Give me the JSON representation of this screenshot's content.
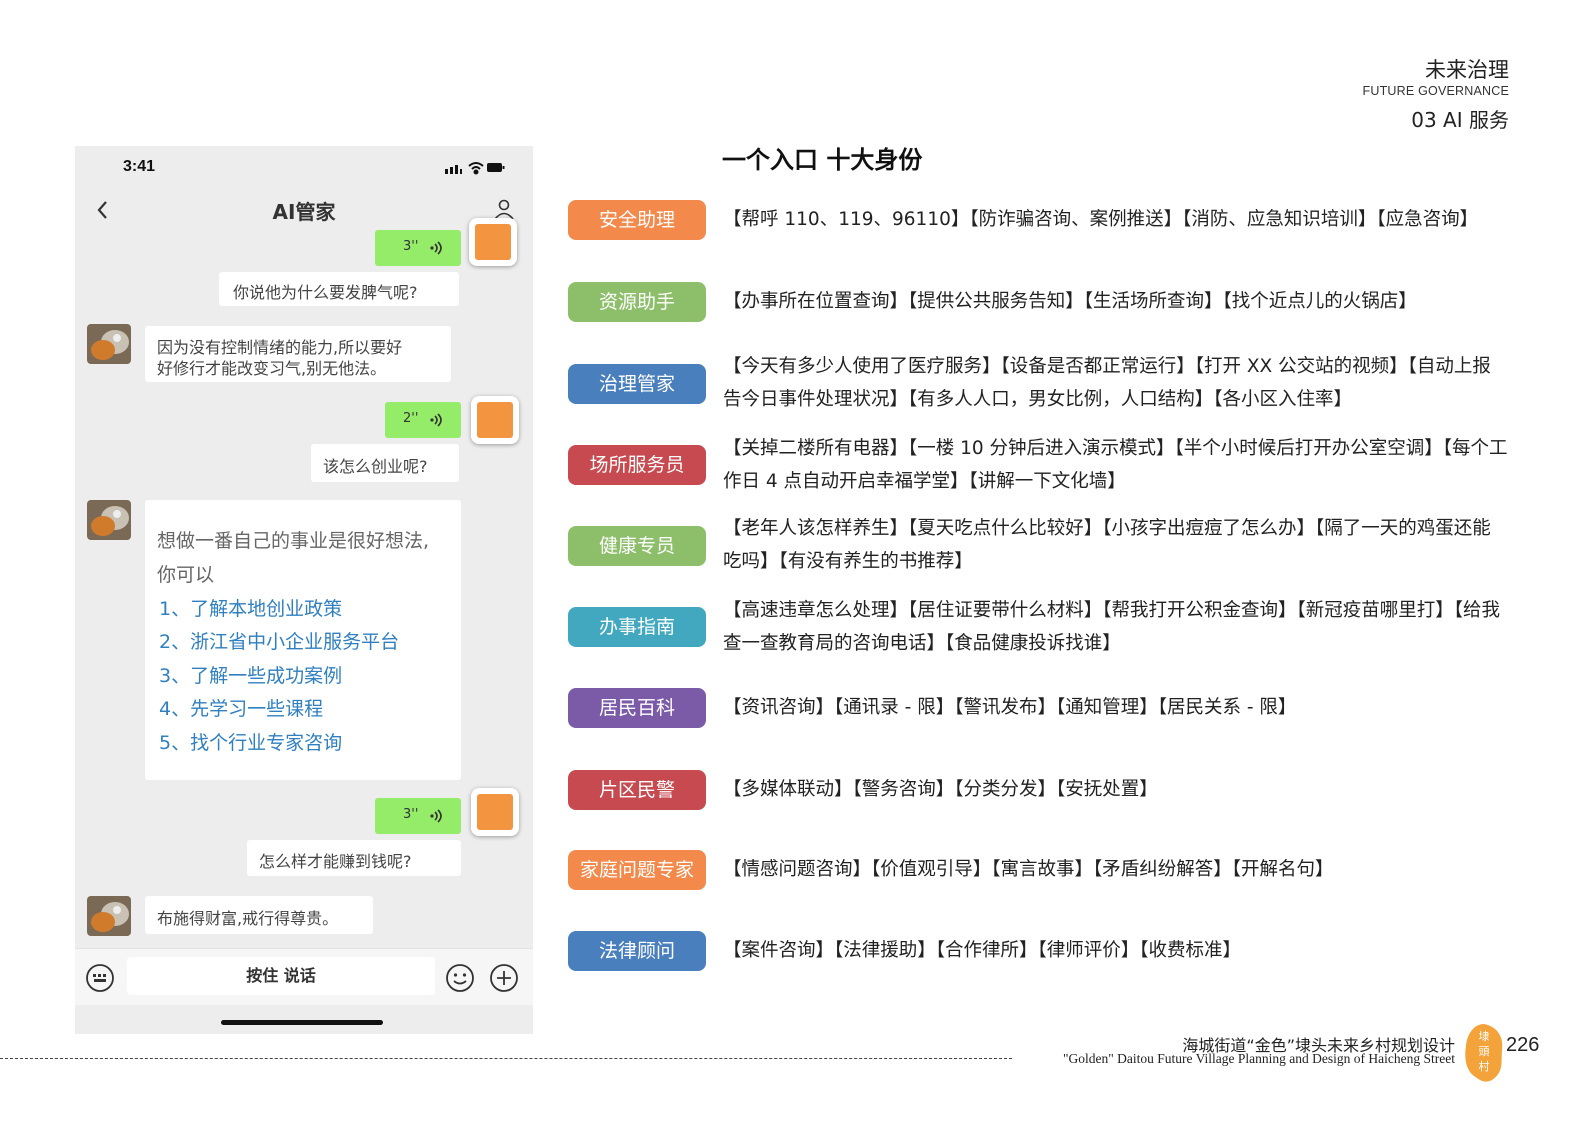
{
  "header": {
    "title_cn": "未来治理",
    "title_en": "FUTURE GOVERNANCE",
    "section": "03 AI 服务"
  },
  "phone": {
    "status_time": "3:41",
    "nav_title": "AI管家",
    "messages": {
      "voice1_duration": "3''",
      "user_text1": "你说他为什么要发脾气呢?",
      "bot_text1_line1": "因为没有控制情绪的能力,所以要好",
      "bot_text1_line2": "好修行才能改变习气,别无他法。",
      "voice2_duration": "2''",
      "user_text2": "该怎么创业呢?",
      "bot_text2_line1": "想做一番自己的事业是很好想法,",
      "bot_text2_line2": "你可以",
      "bot_list": [
        "1、了解本地创业政策",
        "2、浙江省中小企业服务平台",
        "3、了解一些成功案例",
        "4、先学习一些课程",
        "5、找个行业专家咨询"
      ],
      "voice3_duration": "3''",
      "user_text3": "怎么样才能赚到钱呢?",
      "bot_text3": "布施得财富,戒行得尊贵。"
    },
    "input_label": "按住 说话"
  },
  "main": {
    "title": "一个入口   十大身份",
    "roles": [
      {
        "name": "安全助理",
        "color": "#f38a4c",
        "desc": "【帮呼 110、119、96110】【防诈骗咨询、案例推送】【消防、应急知识培训】【应急咨询】"
      },
      {
        "name": "资源助手",
        "color": "#8dbf6b",
        "desc": "【办事所在位置查询】【提供公共服务告知】【生活场所查询】【找个近点儿的火锅店】"
      },
      {
        "name": "治理管家",
        "color": "#4a7fbd",
        "desc": "【今天有多少人使用了医疗服务】【设备是否都正常运行】【打开 XX 公交站的视频】【自动上报告今日事件处理状况】【有多人人口，男女比例，人口结构】【各小区入住率】"
      },
      {
        "name": "场所服务员",
        "color": "#c64a4f",
        "desc": "【关掉二楼所有电器】【一楼 10 分钟后进入演示模式】【半个小时候后打开办公室空调】【每个工作日 4 点自动开启幸福学堂】【讲解一下文化墙】"
      },
      {
        "name": "健康专员",
        "color": "#8dbf6b",
        "desc": "【老年人该怎样养生】【夏天吃点什么比较好】【小孩字出痘痘了怎么办】【隔了一天的鸡蛋还能吃吗】【有没有养生的书推荐】"
      },
      {
        "name": "办事指南",
        "color": "#41a8bf",
        "desc": "【高速违章怎么处理】【居住证要带什么材料】【帮我打开公积金查询】【新冠疫苗哪里打】【给我查一查教育局的咨询电话】【食品健康投诉找谁】"
      },
      {
        "name": "居民百科",
        "color": "#7b5ba7",
        "desc": "【资讯咨询】【通讯录 - 限】【警讯发布】【通知管理】【居民关系 - 限】"
      },
      {
        "name": "片区民警",
        "color": "#c64a4f",
        "desc": "【多媒体联动】【警务咨询】【分类分发】【安抚处置】"
      },
      {
        "name": "家庭问题专家",
        "color": "#f38a4c",
        "desc": "【情感问题咨询】【价值观引导】【寓言故事】【矛盾纠纷解答】【开解名句】"
      },
      {
        "name": "法律顾问",
        "color": "#4a7fbd",
        "desc": "【案件咨询】【法律援助】【合作律所】【律师评价】【收费标准】"
      }
    ]
  },
  "footer": {
    "title_cn": "海城街道“金色”埭头未来乡村规划设计",
    "title_en": "\"Golden\" Daitou Future Village Planning and Design of Haicheng Street",
    "seal_text": "埭头村",
    "page": "226"
  }
}
